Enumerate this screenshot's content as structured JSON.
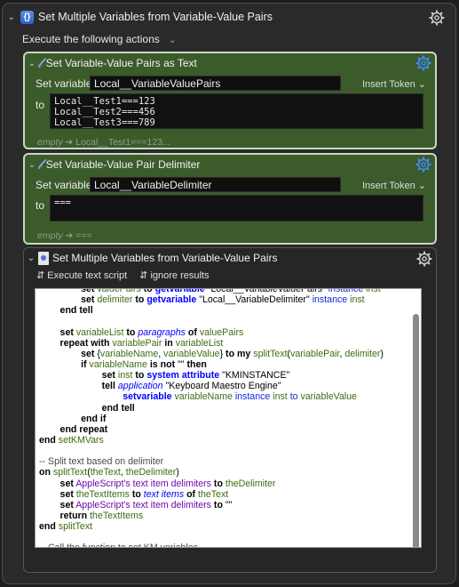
{
  "macro": {
    "title": "Set Multiple Variables from Variable-Value Pairs",
    "group_icon": "{}"
  },
  "execute": {
    "label": "Execute the following actions"
  },
  "action1": {
    "title": "Set Variable-Value Pairs as Text",
    "set_variable_label": "Set variable",
    "variable": "Local__VariableValuePairs",
    "insert_token": "Insert Token",
    "to_label": "to",
    "text_lines": [
      "Local__Test1===123",
      "Local__Test2===456",
      "Local__Test3===789"
    ],
    "empty_prefix": "empty",
    "empty_preview": "Local__Test1===123..."
  },
  "action2": {
    "title": "Set Variable-Value Pair Delimiter",
    "set_variable_label": "Set variable",
    "variable": "Local__VariableDelimiter",
    "insert_token": "Insert Token",
    "to_label": "to",
    "text": "===",
    "empty_prefix": "empty",
    "empty_preview": "==="
  },
  "action3": {
    "title": "Set Multiple Variables from Variable-Value Pairs",
    "execute_script": "Execute text script",
    "ignore_results": "ignore results"
  },
  "icons": {
    "collapse": "chevron-down-icon",
    "settings": "gear-icon",
    "variable_action": "x-variable-icon",
    "script_action": "applescript-icon",
    "arrow": "arrow-right-icon"
  },
  "colors": {
    "background": "#1e1e1e",
    "action_green": "#3b5b2b",
    "gear_blue": "#3d8cf5",
    "code_keyword_blue": "#0000ff",
    "code_variable_green": "#3c6d11",
    "code_property_purple": "#6c0aaa"
  }
}
